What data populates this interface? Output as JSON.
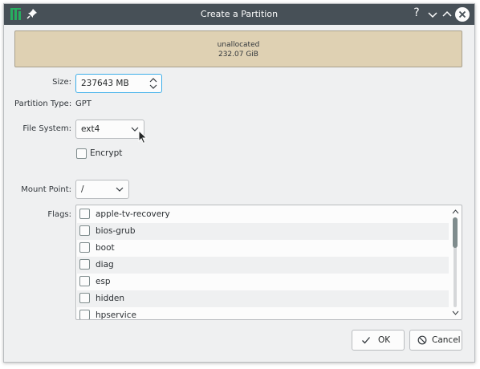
{
  "window": {
    "title": "Create a Partition",
    "help_glyph": "?"
  },
  "partition": {
    "name": "unallocated",
    "size": "232.07 GiB",
    "color": "#dfd1b3"
  },
  "form": {
    "size_label": "Size:",
    "size_value": "237643 MB",
    "partition_type_label": "Partition Type:",
    "partition_type_value": "GPT",
    "file_system_label": "File System:",
    "file_system_value": "ext4",
    "encrypt_label": "Encrypt",
    "encrypt_checked": false,
    "mount_point_label": "Mount Point:",
    "mount_point_value": "/",
    "flags_label": "Flags:"
  },
  "flags": [
    {
      "label": "apple-tv-recovery",
      "checked": false
    },
    {
      "label": "bios-grub",
      "checked": false
    },
    {
      "label": "boot",
      "checked": false
    },
    {
      "label": "diag",
      "checked": false
    },
    {
      "label": "esp",
      "checked": false
    },
    {
      "label": "hidden",
      "checked": false
    },
    {
      "label": "hpservice",
      "checked": false
    }
  ],
  "buttons": {
    "ok_label": "OK",
    "cancel_label": "Cancel"
  },
  "icons": {
    "app": "calamares-app-icon",
    "pin": "pin-icon",
    "minimize": "chevron-down-icon",
    "maximize": "chevron-up-icon",
    "close": "close-icon",
    "ok": "checkmark-icon",
    "cancel": "cancel-icon"
  },
  "colors": {
    "titlebar": "#475057",
    "accent": "#3daee9",
    "app_icon": "#27ae60"
  }
}
